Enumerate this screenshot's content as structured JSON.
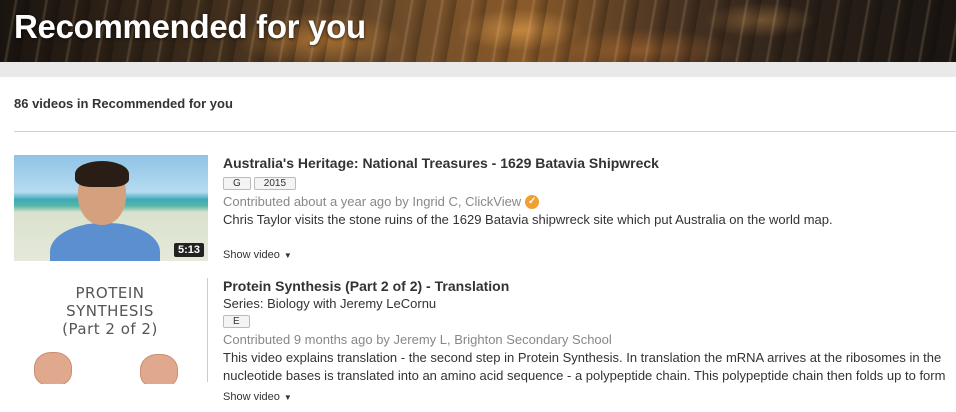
{
  "banner": {
    "title": "Recommended for you"
  },
  "list_header": {
    "count_text": "86 videos in Recommended for you"
  },
  "videos": [
    {
      "title": "Australia's Heritage: National Treasures - 1629 Batavia Shipwreck",
      "badges": [
        "G",
        "2015"
      ],
      "contributed": "Contributed about a year ago by Ingrid C, ClickView",
      "verified_icon": "verified-badge-icon",
      "description": "Chris Taylor visits the stone ruins of the 1629 Batavia shipwreck site which put Australia on the world map.",
      "duration": "5:13",
      "show_video_label": "Show video"
    },
    {
      "title": "Protein Synthesis (Part 2 of 2) - Translation",
      "series": "Series: Biology with Jeremy LeCornu",
      "badges": [
        "E"
      ],
      "contributed": "Contributed 9 months ago by Jeremy L, Brighton Secondary School",
      "description_lines": [
        "This video explains translation - the second step in Protein Synthesis. In translation the mRNA arrives at the ribosomes in the",
        "nucleotide bases is translated into an amino acid sequence - a polypeptide chain. This polypeptide chain then folds up to form"
      ],
      "thumbnail_text": [
        "PROTEIN SYNTHESIS",
        "(Part 2 of 2)"
      ],
      "show_video_label": "Show video"
    }
  ],
  "colors": {
    "verified_badge": "#f0a030",
    "muted_text": "#888888"
  }
}
